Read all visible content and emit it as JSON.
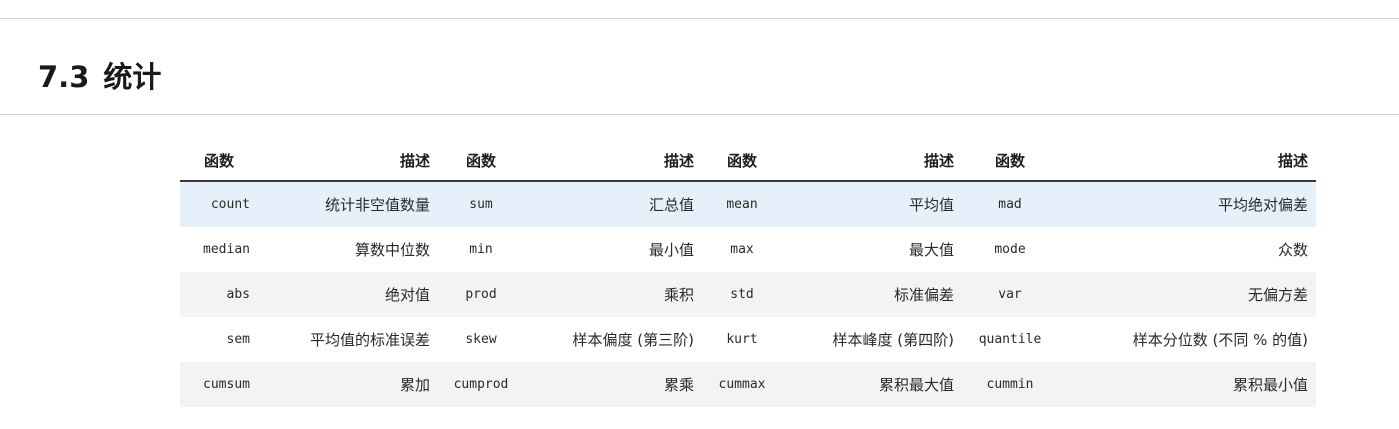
{
  "section": {
    "number": "7.3",
    "title": "统计"
  },
  "table": {
    "headers": [
      "函数",
      "描述",
      "函数",
      "描述",
      "函数",
      "描述",
      "函数",
      "描述"
    ],
    "rows": [
      [
        "count",
        "统计非空值数量",
        "sum",
        "汇总值",
        "mean",
        "平均值",
        "mad",
        "平均绝对偏差"
      ],
      [
        "median",
        "算数中位数",
        "min",
        "最小值",
        "max",
        "最大值",
        "mode",
        "众数"
      ],
      [
        "abs",
        "绝对值",
        "prod",
        "乘积",
        "std",
        "标准偏差",
        "var",
        "无偏方差"
      ],
      [
        "sem",
        "平均值的标准误差",
        "skew",
        "样本偏度 (第三阶)",
        "kurt",
        "样本峰度 (第四阶)",
        "quantile",
        "样本分位数 (不同 % 的值)"
      ],
      [
        "cumsum",
        "累加",
        "cumprod",
        "累乘",
        "cummax",
        "累积最大值",
        "cummin",
        "累积最小值"
      ]
    ]
  }
}
